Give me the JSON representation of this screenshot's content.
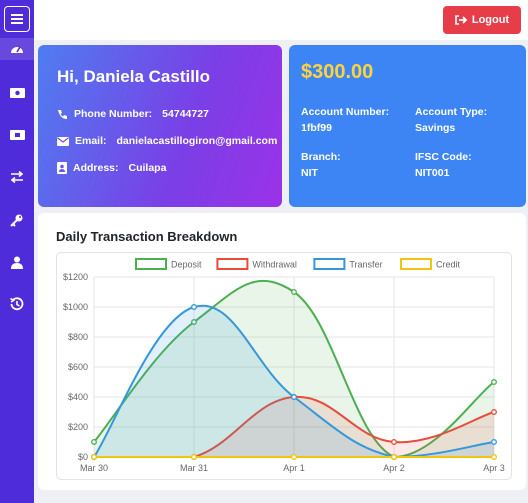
{
  "sidebar": {
    "items": [
      {
        "icon": "tachometer-icon"
      },
      {
        "icon": "money-bill-icon"
      },
      {
        "icon": "money-bill-alt-icon"
      },
      {
        "icon": "exchange-icon"
      },
      {
        "icon": "key-icon"
      },
      {
        "icon": "user-icon"
      },
      {
        "icon": "history-icon"
      }
    ]
  },
  "header": {
    "logout_label": "Logout"
  },
  "user": {
    "greeting": "Hi, Daniela Castillo",
    "phone_label": "Phone Number:",
    "phone": "54744727",
    "email_label": "Email:",
    "email": "danielacastillogiron@gmail.com",
    "address_label": "Address:",
    "address": "Cuilapa"
  },
  "account": {
    "balance": "$300.00",
    "number_label": "Account Number:",
    "number": "1fbf99",
    "type_label": "Account Type:",
    "type": "Savings",
    "branch_label": "Branch:",
    "branch": "NIT",
    "ifsc_label": "IFSC Code:",
    "ifsc": "NIT001"
  },
  "colors": {
    "sidebar": "#4f2cd9",
    "logout": "#e63d49",
    "account_card": "#3d85f5",
    "balance": "#ffd43b"
  },
  "chart_title": "Daily Transaction Breakdown",
  "chart_data": {
    "type": "line",
    "x": [
      "Mar 30",
      "Mar 31",
      "Apr 1",
      "Apr 2",
      "Apr 3"
    ],
    "ylim": [
      0,
      1200
    ],
    "yticks": [
      "$0",
      "$200",
      "$400",
      "$600",
      "$800",
      "$1000",
      "$1200"
    ],
    "legend_position": "top",
    "grid": true,
    "series": [
      {
        "name": "Deposit",
        "values": [
          100,
          900,
          1100,
          0,
          500
        ],
        "color": "#4caf50"
      },
      {
        "name": "Withdrawal",
        "values": [
          0,
          0,
          400,
          100,
          300
        ],
        "color": "#e74c3c"
      },
      {
        "name": "Transfer",
        "values": [
          0,
          1000,
          400,
          0,
          100
        ],
        "color": "#3498db"
      },
      {
        "name": "Credit",
        "values": [
          0,
          0,
          0,
          0,
          0
        ],
        "color": "#f1c40f"
      }
    ]
  }
}
